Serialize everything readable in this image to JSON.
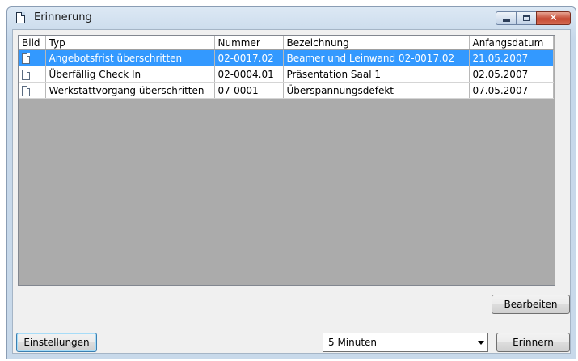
{
  "window": {
    "title": "Erinnerung",
    "close_glyph": "✕"
  },
  "table": {
    "columns": [
      "Bild",
      "Typ",
      "Nummer",
      "Bezeichnung",
      "Anfangsdatum"
    ],
    "rows": [
      {
        "icon": "document-icon",
        "typ": "Angebotsfrist überschritten",
        "nummer": "02-0017.02",
        "bezeichnung": "Beamer und Leinwand 02-0017.02",
        "anfangsdatum": "21.05.2007",
        "selected": true
      },
      {
        "icon": "document-icon",
        "typ": "Überfällig Check In",
        "nummer": "02-0004.01",
        "bezeichnung": "Präsentation Saal 1",
        "anfangsdatum": "02.05.2007",
        "selected": false
      },
      {
        "icon": "document-icon",
        "typ": "Werkstattvorgang überschritten",
        "nummer": "07-0001",
        "bezeichnung": "Überspannungsdefekt",
        "anfangsdatum": "07.05.2007",
        "selected": false
      }
    ]
  },
  "buttons": {
    "bearbeiten": "Bearbeiten",
    "einstellungen": "Einstellungen",
    "erinnern": "Erinnern"
  },
  "interval_select": {
    "value": "5 Minuten"
  },
  "colors": {
    "selection": "#3399ff",
    "grid_background": "#ababab"
  }
}
